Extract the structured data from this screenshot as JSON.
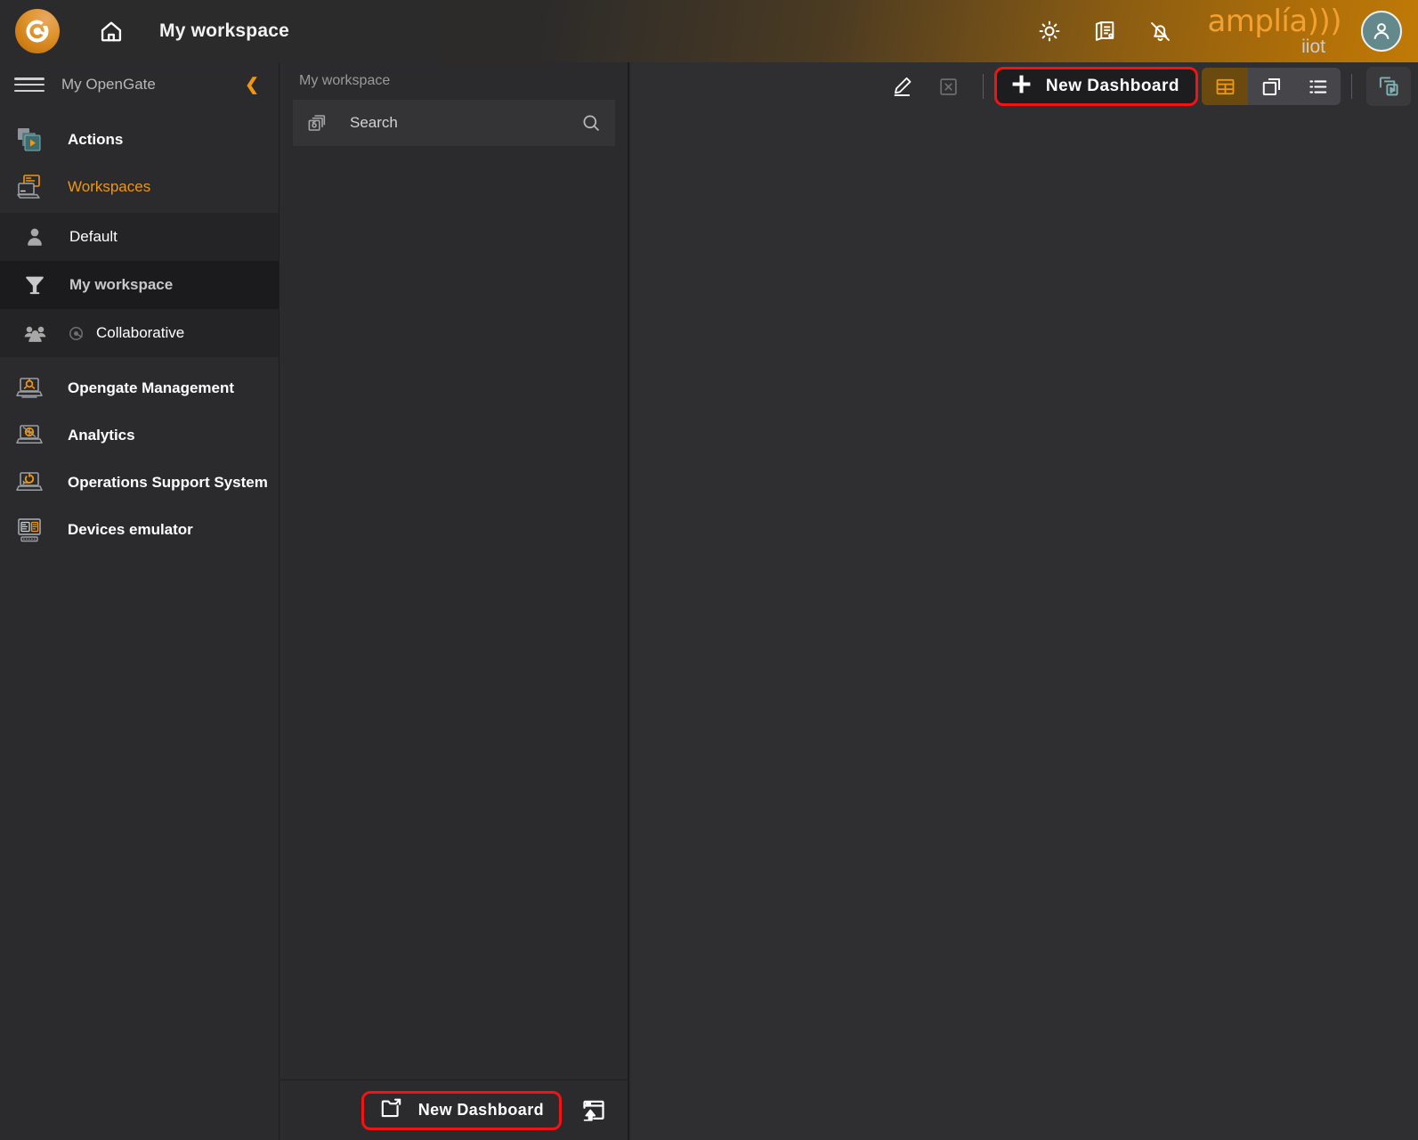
{
  "header": {
    "logo_icon": "opengate-logo-icon",
    "home_icon": "home-icon",
    "workspace_title": "My workspace",
    "brightness_icon": "brightness-icon",
    "docs_icon": "documents-icon",
    "notifications_off_icon": "bell-off-icon",
    "brand_primary": "amplía)))",
    "brand_secondary": "iiot",
    "avatar_icon": "user-avatar-icon",
    "accent_color": "#f0960f",
    "brand_color": "#f2a030"
  },
  "sidebar": {
    "menu_icon": "hamburger-menu-icon",
    "title": "My OpenGate",
    "collapse_icon": "chevron-left-icon",
    "top_items": [
      {
        "label": "Actions",
        "icon": "actions-icon",
        "active": false
      },
      {
        "label": "Workspaces",
        "icon": "workspaces-icon",
        "active": true
      }
    ],
    "workspace_items": [
      {
        "label": "Default",
        "icon": "person-icon",
        "selected": false,
        "shared": false
      },
      {
        "label": "My workspace",
        "icon": "funnel-icon",
        "selected": true,
        "shared": false
      },
      {
        "label": "Collaborative",
        "icon": "group-icon",
        "selected": false,
        "shared": true,
        "shared_icon": "opengate-mini-icon"
      }
    ],
    "bottom_items": [
      {
        "label": "Opengate Management",
        "icon": "opengate-management-icon"
      },
      {
        "label": "Analytics",
        "icon": "analytics-icon"
      },
      {
        "label": "Operations Support System",
        "icon": "oss-icon"
      },
      {
        "label": "Devices emulator",
        "icon": "devices-emulator-icon"
      }
    ]
  },
  "panel": {
    "heading": "My workspace",
    "search": {
      "prefix_icon": "dashboards-icon",
      "placeholder": "Search",
      "value": "",
      "search_icon": "magnifier-icon"
    },
    "footer": {
      "new_dashboard_label": "New Dashboard",
      "new_dashboard_icon": "new-dashboard-folder-icon",
      "import_icon": "import-dashboard-icon",
      "highlight_color": "#f21414"
    }
  },
  "toolbar": {
    "edit_icon": "pencil-edit-icon",
    "close_icon": "close-box-icon",
    "new_dashboard_label": "New Dashboard",
    "plus_icon": "plus-icon",
    "highlight_color": "#f21414",
    "view_modes": [
      {
        "icon": "grid-view-icon",
        "active": true
      },
      {
        "icon": "cards-view-icon",
        "active": false
      },
      {
        "icon": "list-view-icon",
        "active": false
      }
    ],
    "slideshow_icon": "slideshow-icon"
  }
}
